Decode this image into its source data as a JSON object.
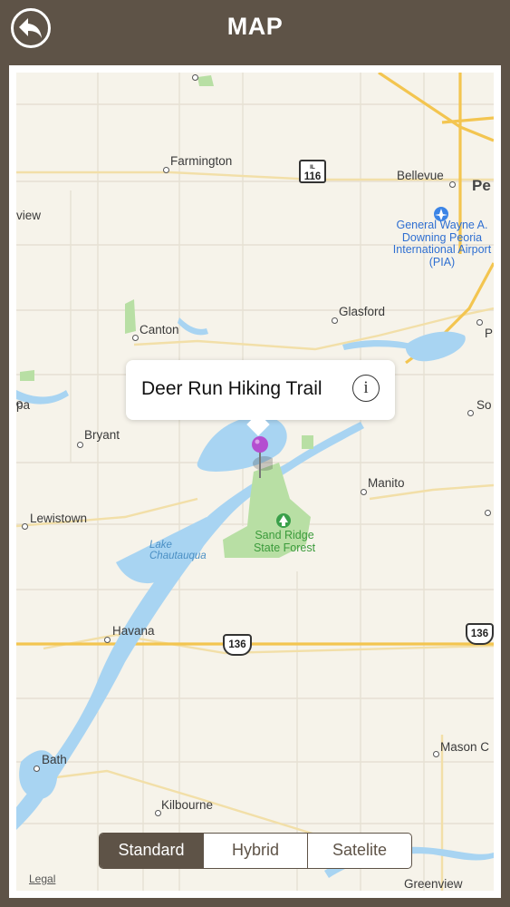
{
  "header": {
    "title": "MAP",
    "back_icon": "back-arrow-icon"
  },
  "map": {
    "callout": {
      "title": "Deer Run Hiking Trail",
      "info_icon": "info-icon",
      "info_glyph": "i"
    },
    "pin_color": "#b44fd0",
    "places": {
      "farmington": "Farmington",
      "bellevue": "Bellevue",
      "pe": "Pe",
      "view": "view",
      "airport": "General Wayne A. Downing Peoria International Airport (PIA)",
      "canton": "Canton",
      "glasford": "Glasford",
      "p": "P",
      "pa": "pa",
      "so": "So",
      "bryant": "Bryant",
      "manito": "Manito",
      "lewistown": "Lewistown",
      "forest": "Sand Ridge State Forest",
      "lake": "Lake Chautauqua",
      "havana": "Havana",
      "mason": "Mason C",
      "bath": "Bath",
      "kilbourne": "Kilbourne",
      "greenview": "Greenview"
    },
    "shields": {
      "il116_state": "IL",
      "il116": "116",
      "us136_left": "136",
      "us136_right": "136"
    },
    "legal": "Legal"
  },
  "map_type": {
    "options": [
      "Standard",
      "Hybrid",
      "Satelite"
    ],
    "selected": "Standard"
  },
  "colors": {
    "header_bg": "#5e5347",
    "water": "#a8d4f2",
    "park": "#b8dfa4",
    "highway": "#f3c550"
  }
}
